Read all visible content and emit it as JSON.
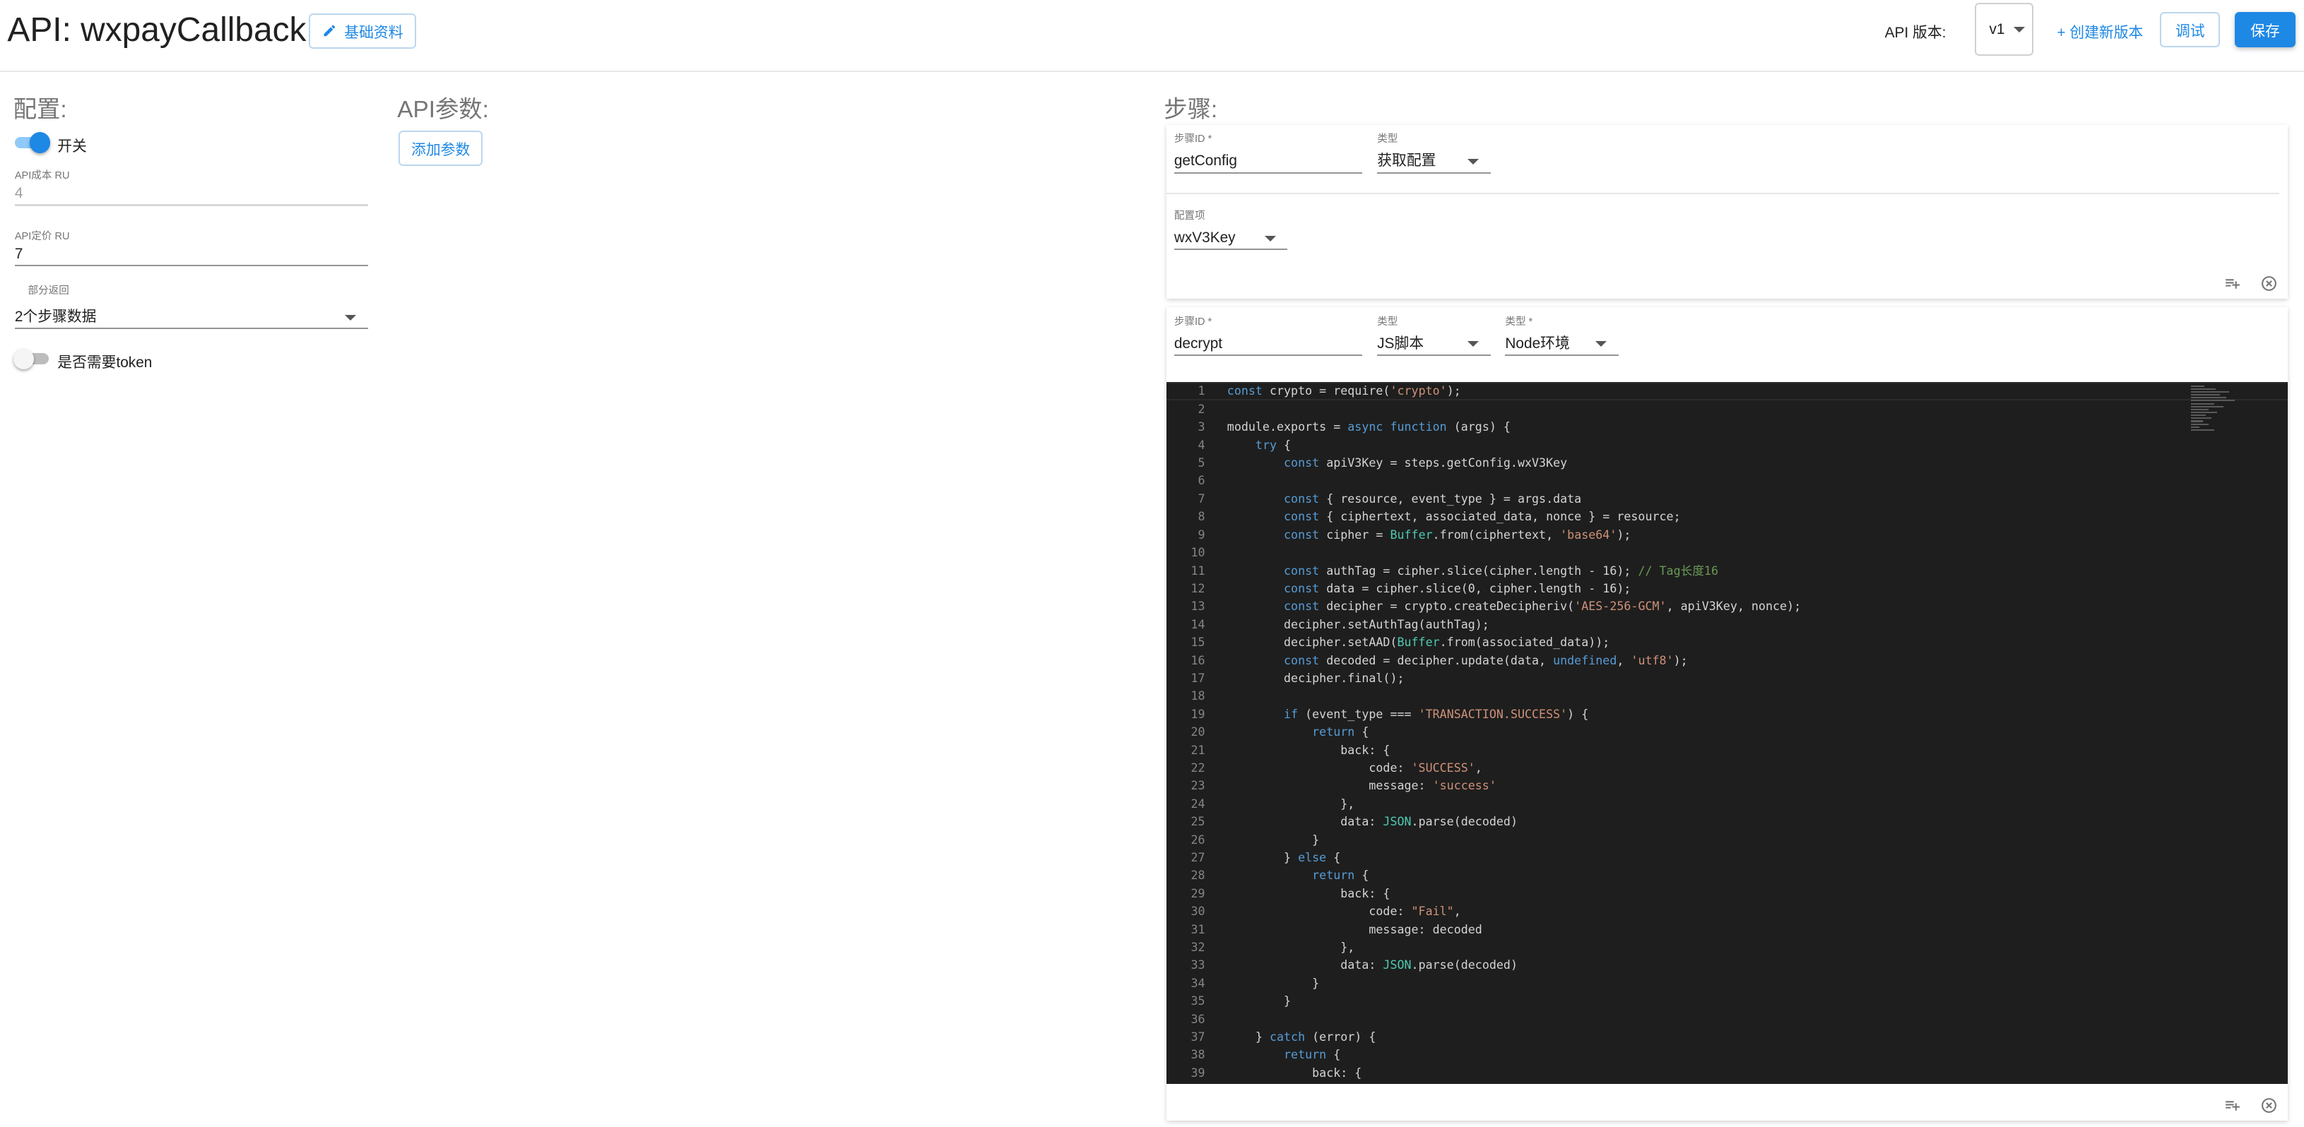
{
  "header": {
    "title": "API: wxpayCallback",
    "basic_info_label": "基础资料",
    "version_label": "API 版本:",
    "version_value": "v1",
    "create_version_label": "+ 创建新版本",
    "debug_label": "调试",
    "save_label": "保存"
  },
  "config": {
    "title": "配置:",
    "switch_label": "开关",
    "switch_on": true,
    "cost_label": "API成本 RU",
    "cost_value": "4",
    "price_label": "API定价 RU",
    "price_value": "7",
    "partial_return_label": "部分返回",
    "partial_return_value": "2个步骤数据",
    "need_token_label": "是否需要token",
    "need_token_on": false
  },
  "params": {
    "title": "API参数:",
    "add_param_label": "添加参数"
  },
  "steps": {
    "title": "步骤:",
    "items": [
      {
        "id_label": "步骤ID *",
        "id_value": "getConfig",
        "type_label": "类型",
        "type_value": "获取配置",
        "config_label": "配置项",
        "config_value": "wxV3Key"
      },
      {
        "id_label": "步骤ID *",
        "id_value": "decrypt",
        "type_label": "类型",
        "type_value": "JS脚本",
        "env_label": "类型 *",
        "env_value": "Node环境"
      }
    ]
  },
  "editor": {
    "lines": [
      "const crypto = require('crypto');",
      "",
      "module.exports = async function (args) {",
      "    try {",
      "        const apiV3Key = steps.getConfig.wxV3Key",
      "",
      "        const { resource, event_type } = args.data",
      "        const { ciphertext, associated_data, nonce } = resource;",
      "        const cipher = Buffer.from(ciphertext, 'base64');",
      "",
      "        const authTag = cipher.slice(cipher.length - 16); // Tag长度16",
      "        const data = cipher.slice(0, cipher.length - 16);",
      "        const decipher = crypto.createDecipheriv('AES-256-GCM', apiV3Key, nonce);",
      "        decipher.setAuthTag(authTag);",
      "        decipher.setAAD(Buffer.from(associated_data));",
      "        const decoded = decipher.update(data, undefined, 'utf8');",
      "        decipher.final();",
      "",
      "        if (event_type === 'TRANSACTION.SUCCESS') {",
      "            return {",
      "                back: {",
      "                    code: 'SUCCESS',",
      "                    message: 'success'",
      "                },",
      "                data: JSON.parse(decoded)",
      "            }",
      "        } else {",
      "            return {",
      "                back: {",
      "                    code: \"Fail\",",
      "                    message: decoded",
      "                },",
      "                data: JSON.parse(decoded)",
      "            }",
      "        }",
      "",
      "    } catch (error) {",
      "        return {",
      "            back: {"
    ]
  },
  "colors": {
    "accent": "#1e88e5",
    "editor_bg": "#1e1e1e",
    "keyword": "#569cd6",
    "string": "#ce9178",
    "class": "#4ec9b0",
    "comment": "#6a9955"
  },
  "icons": [
    "pencil-icon",
    "chevron-down-icon",
    "playlist-add-icon",
    "close-circle-icon"
  ]
}
